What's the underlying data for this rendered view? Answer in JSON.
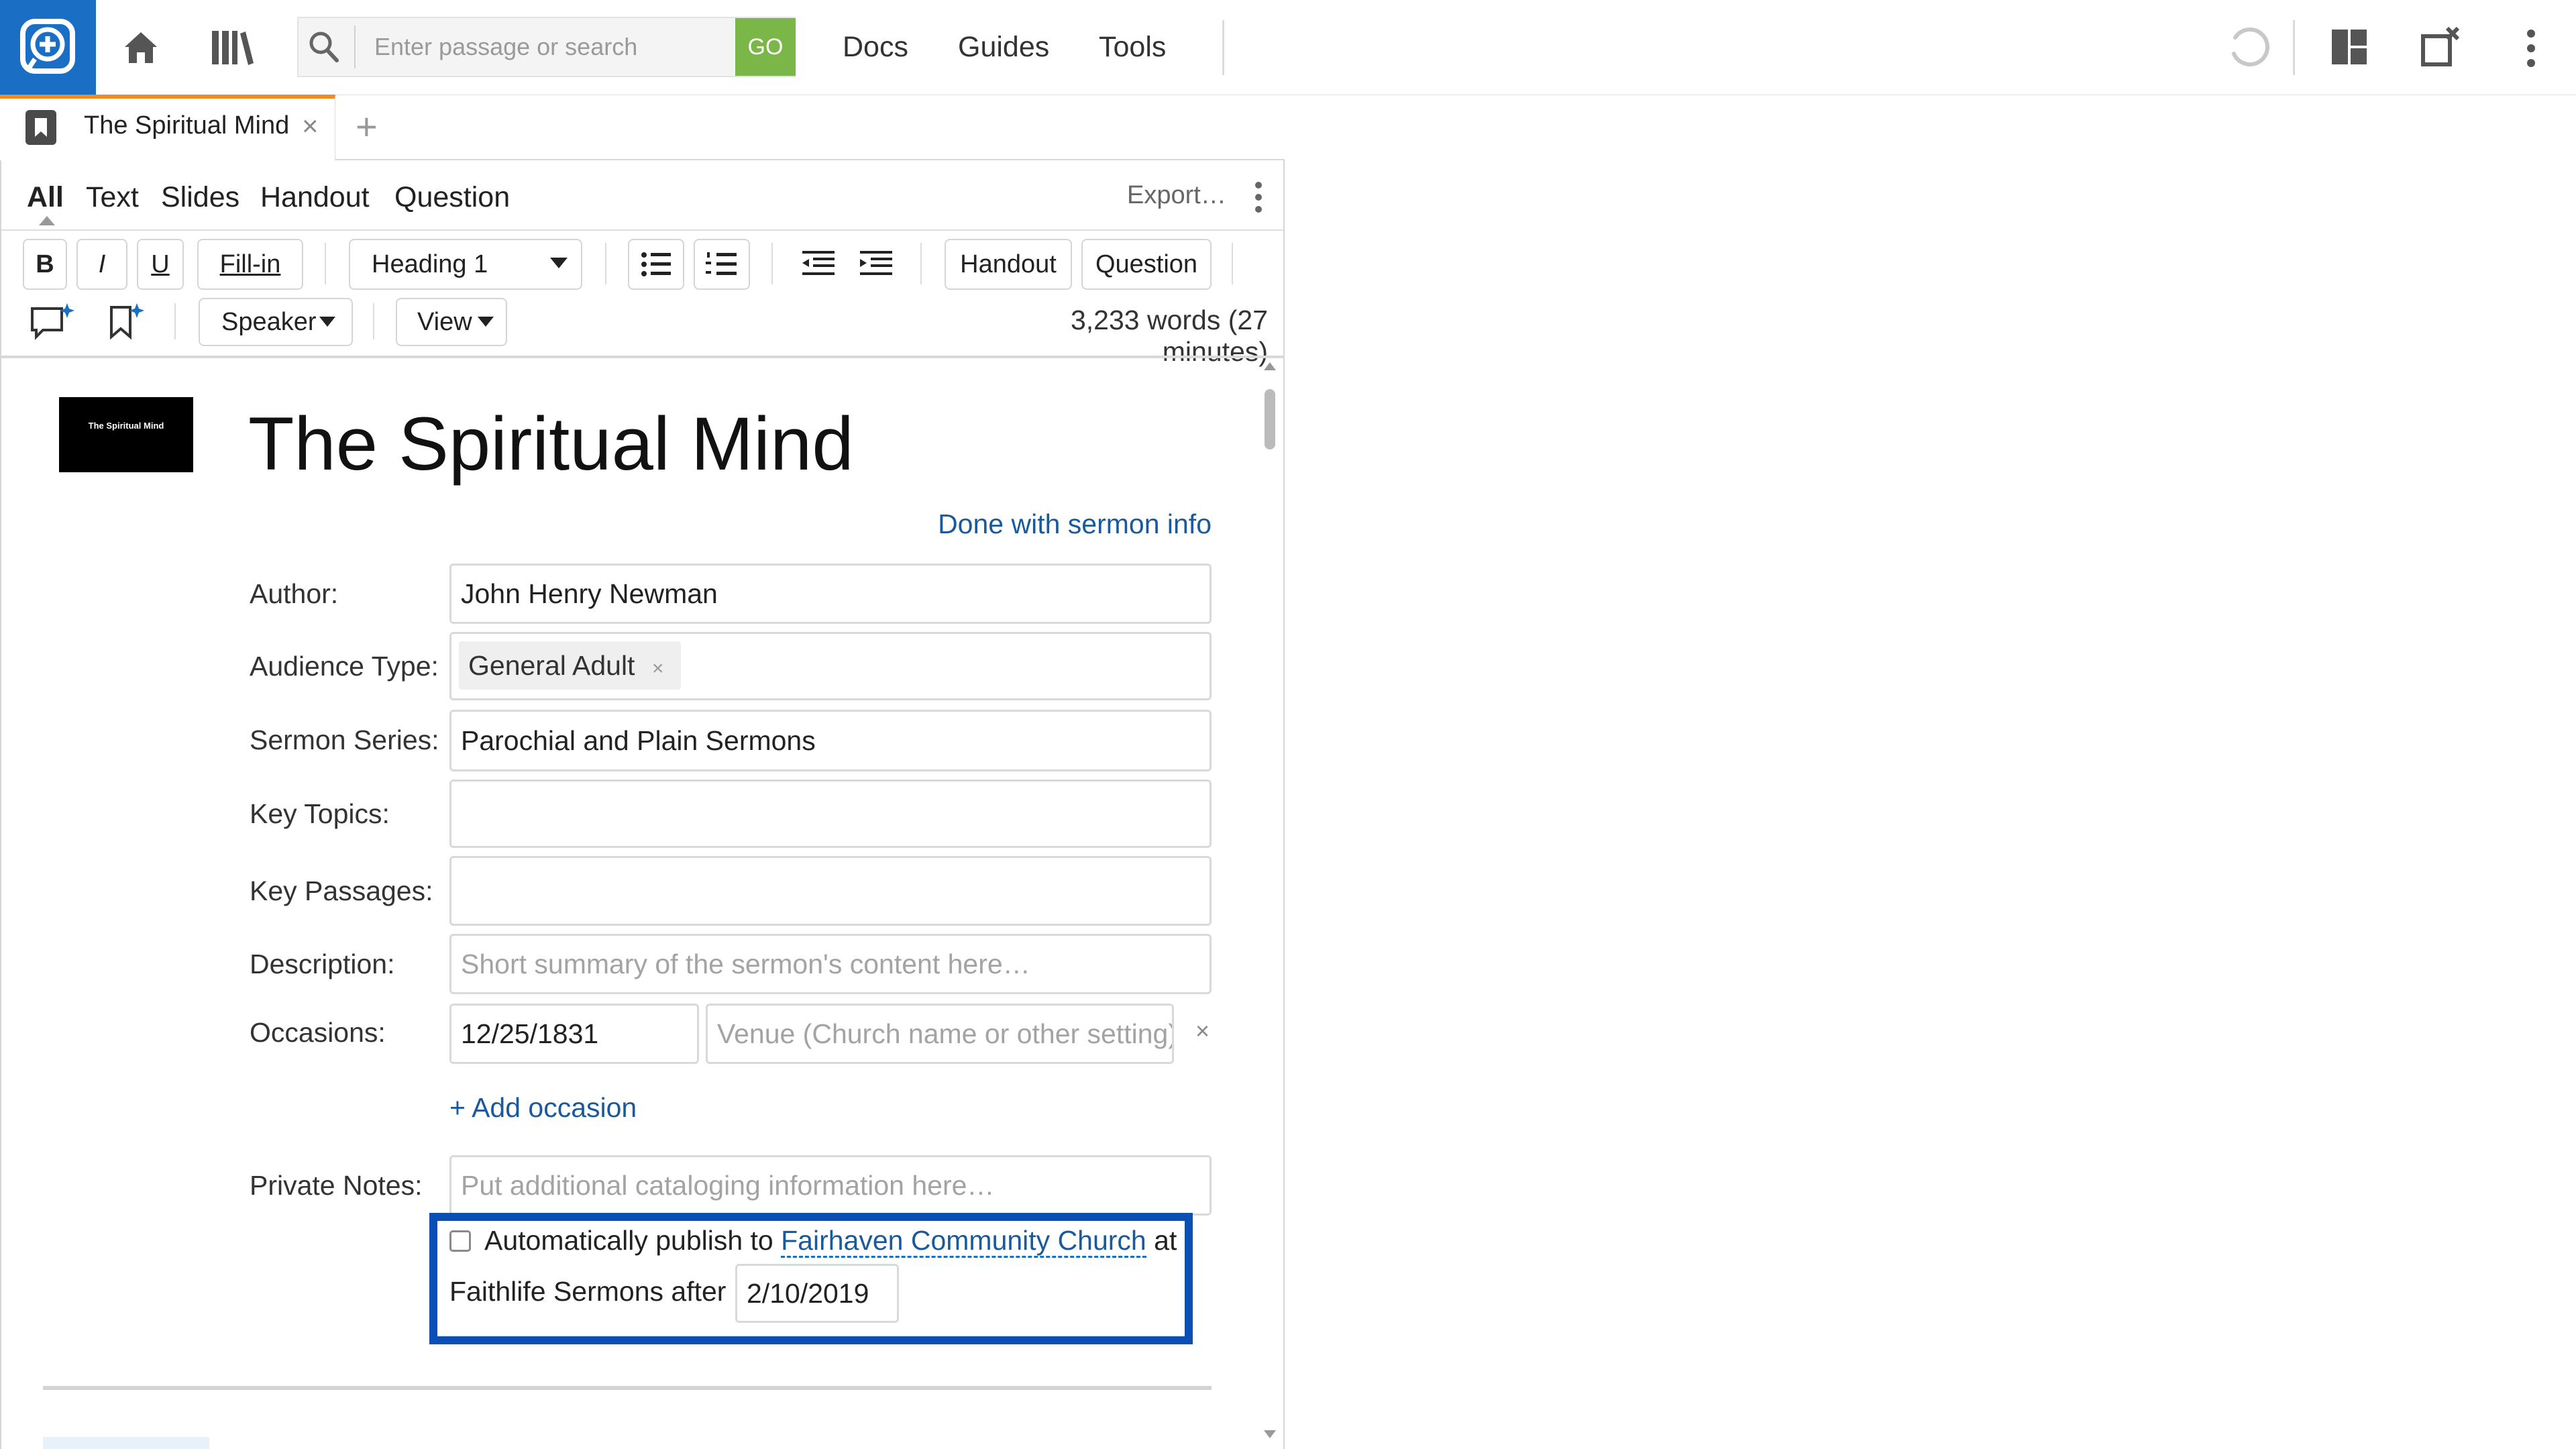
{
  "topbar": {
    "search_placeholder": "Enter passage or search",
    "go_label": "GO",
    "menu": [
      "Docs",
      "Guides",
      "Tools"
    ]
  },
  "tabs": {
    "active_title": "The Spiritual Mind",
    "close_glyph": "×",
    "new_tab_glyph": "+"
  },
  "editor": {
    "modes": [
      "All",
      "Text",
      "Slides",
      "Handout",
      "Question"
    ],
    "active_mode": "All",
    "export_label": "Export…",
    "toolbar": {
      "bold": "B",
      "italic": "I",
      "underline": "U",
      "fillin": "Fill-in",
      "style_select": "Heading 1",
      "handout": "Handout",
      "question": "Question",
      "speaker": "Speaker",
      "view": "View"
    },
    "word_count": "3,233 words (27 minutes)"
  },
  "sermon": {
    "thumbnail_text": "The Spiritual Mind",
    "title": "The Spiritual Mind",
    "done_link": "Done with sermon info",
    "labels": {
      "author": "Author:",
      "audience": "Audience Type:",
      "series": "Sermon Series:",
      "topics": "Key Topics:",
      "passages": "Key Passages:",
      "description": "Description:",
      "occasions": "Occasions:",
      "notes": "Private Notes:"
    },
    "author": "John Henry Newman",
    "audience_tag": "General Adult",
    "tag_remove": "×",
    "series": "Parochial and Plain Sermons",
    "topics": "",
    "passages": "",
    "description_placeholder": "Short summary of the sermon's content here…",
    "occasion_date": "12/25/1831",
    "venue_placeholder": "Venue (Church name or other setting)",
    "occasion_remove": "×",
    "add_occasion": "+ Add occasion",
    "notes_placeholder": "Put additional cataloging information here…",
    "publish": {
      "prefix": "Automatically publish to",
      "church": "Fairhaven Community Church",
      "suffix": "at",
      "line2": "Faithlife Sermons after",
      "date": "2/10/2019"
    }
  },
  "colors": {
    "brand_blue": "#1a6fc4",
    "go_green": "#7ab648",
    "tab_accent": "#f08a24",
    "link": "#1a5a9c",
    "highlight_border": "#0a4fb5"
  }
}
